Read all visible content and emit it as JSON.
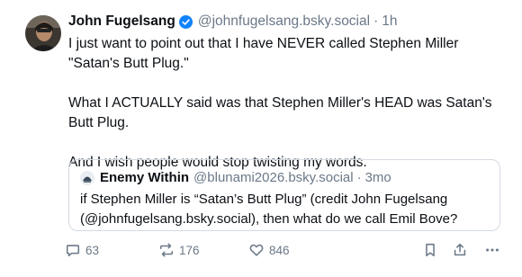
{
  "post": {
    "display_name": "John Fugelsang",
    "handle": "@johnfugelsang.bsky.social",
    "separator": "·",
    "time": "1h",
    "paragraphs": [
      "I just want to point out that I have NEVER called Stephen Miller \"Satan's Butt Plug.\"",
      "What I ACTUALLY said was that Stephen Miller's HEAD was Satan's Butt Plug.",
      "And I wish people would stop twisting my words."
    ],
    "verified_icon": "verified-check-icon",
    "verified_color": "#1083fe"
  },
  "quote": {
    "display_name": "Enemy Within",
    "handle": "@blunami2026.bsky.social",
    "separator": "·",
    "time": "3mo",
    "text": "if Stephen Miller is “Satan’s Butt Plug” (credit John Fugelsang (@johnfugelsang.bsky.social), then what do we call Emil Bove?"
  },
  "actions": {
    "reply_count": "63",
    "repost_count": "176",
    "like_count": "846",
    "icons": [
      "reply-icon",
      "repost-icon",
      "like-icon",
      "bookmark-icon",
      "share-icon",
      "more-icon"
    ]
  },
  "colors": {
    "text": "#0b0f14",
    "muted": "#6b7888",
    "border": "#d4dbe2"
  }
}
